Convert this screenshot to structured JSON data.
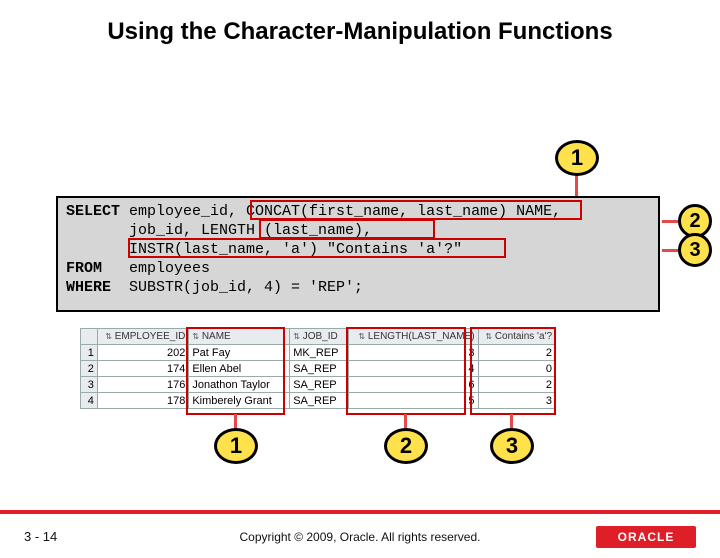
{
  "title": "Using the Character-Manipulation Functions",
  "callouts": {
    "top": "1",
    "right2": "2",
    "right3": "3",
    "bot1": "1",
    "bot2": "2",
    "bot3": "3"
  },
  "sql": {
    "kw_select": "SELECT",
    "l1a": " employee_id, ",
    "l1b": "CONCAT(first_name, last_name) NAME",
    "l1c": ",",
    "l2a": "       job_id, ",
    "l2b": "LENGTH (last_name)",
    "l2c": ",",
    "l3a": "       ",
    "l3b": "INSTR(last_name, 'a') \"Contains 'a'?\"",
    "kw_from": "FROM",
    "l4": "   employees",
    "kw_where": "WHERE",
    "l5": "  SUBSTR(job_id, 4) = 'REP';"
  },
  "results": {
    "headers": [
      "",
      "EMPLOYEE_ID",
      "NAME",
      "JOB_ID",
      "LENGTH(LAST_NAME)",
      "Contains 'a'?"
    ],
    "rows": [
      [
        "1",
        "202",
        "Pat Fay",
        "MK_REP",
        "3",
        "2"
      ],
      [
        "2",
        "174",
        "Ellen Abel",
        "SA_REP",
        "4",
        "0"
      ],
      [
        "3",
        "176",
        "Jonathon Taylor",
        "SA_REP",
        "6",
        "2"
      ],
      [
        "4",
        "178",
        "Kimberely Grant",
        "SA_REP",
        "5",
        "3"
      ]
    ]
  },
  "footer": {
    "slidenum": "3 - 14",
    "copyright": "Copyright © 2009, Oracle. All rights reserved.",
    "logo": "ORACLE"
  }
}
